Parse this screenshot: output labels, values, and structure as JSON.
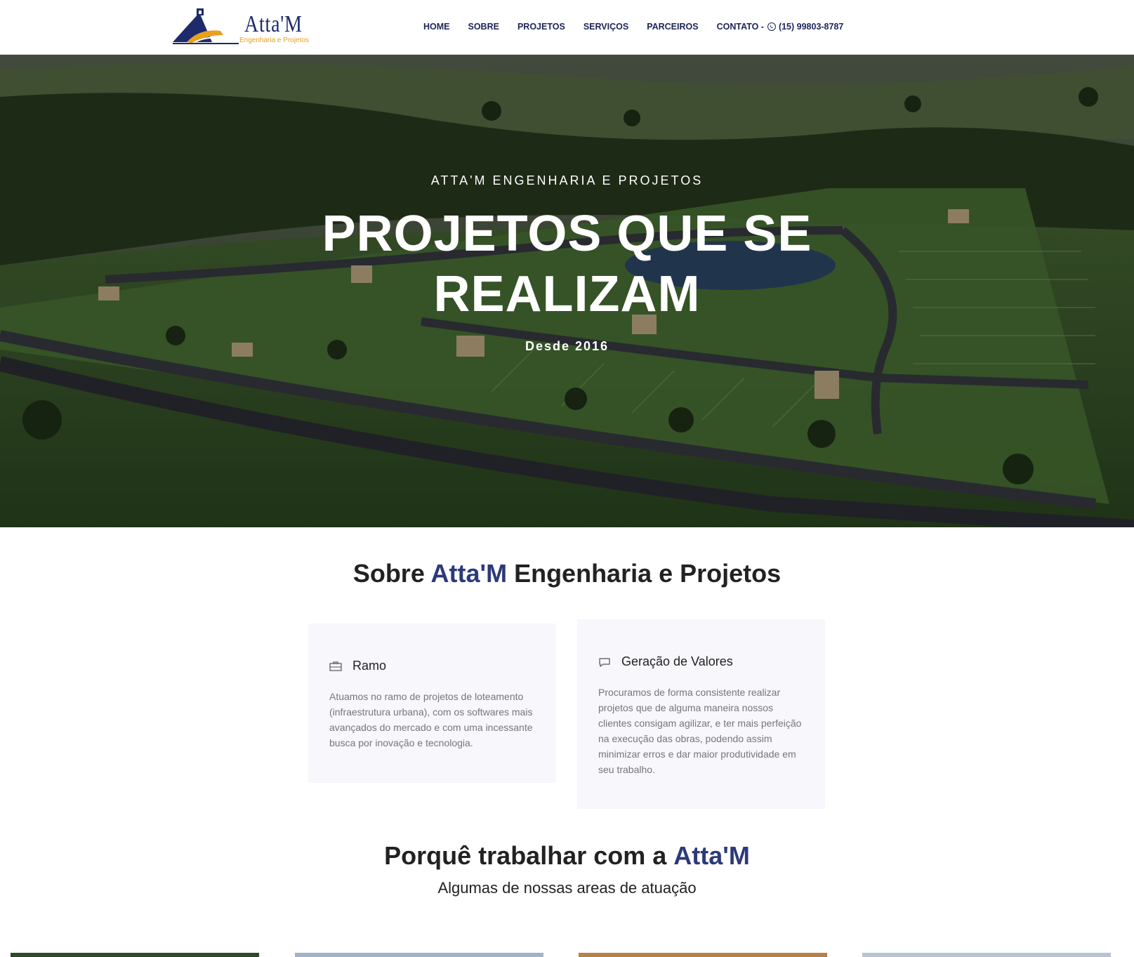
{
  "header": {
    "logo": {
      "name": "Atta'M",
      "tagline": "Engenharia e Projetos"
    },
    "nav": [
      {
        "label": "HOME"
      },
      {
        "label": "SOBRE"
      },
      {
        "label": "PROJETOS"
      },
      {
        "label": "SERVIÇOS"
      },
      {
        "label": "PARCEIROS"
      }
    ],
    "contact": {
      "label": "CONTATO -",
      "icon": "whatsapp-icon",
      "phone": "(15) 99803-8787"
    }
  },
  "hero": {
    "eyebrow": "ATTA'M ENGENHARIA E PROJETOS",
    "title_line1": "PROJETOS QUE SE",
    "title_line2": "REALIZAM",
    "since": "Desde 2016"
  },
  "about": {
    "title_pre": "Sobre ",
    "title_accent": "Atta'M",
    "title_post": " Engenharia e Projetos",
    "cards": [
      {
        "icon": "briefcase-icon",
        "title": "Ramo",
        "text": "Atuamos no ramo de projetos de loteamento (infraestrutura urbana), com os softwares mais avançados do mercado e com uma incessante busca por inovação e tecnologia."
      },
      {
        "icon": "chat-bubble-icon",
        "title": "Geração de Valores",
        "text": "Procuramos de forma consistente realizar projetos que de alguma maneira nossos clientes consigam agilizar, e ter mais perfeição na execução das obras, podendo assim minimizar erros e dar maior produtividade em seu trabalho."
      }
    ]
  },
  "why": {
    "title_pre": "Porquê trabalhar com a ",
    "title_accent": "Atta'M",
    "subtitle": "Algumas de nossas areas de atuação"
  },
  "colors": {
    "brand_navy": "#1d2458",
    "accent_blue": "#2c3a7a",
    "logo_orange": "#e8a020",
    "card_bg": "#f7f7fc"
  }
}
